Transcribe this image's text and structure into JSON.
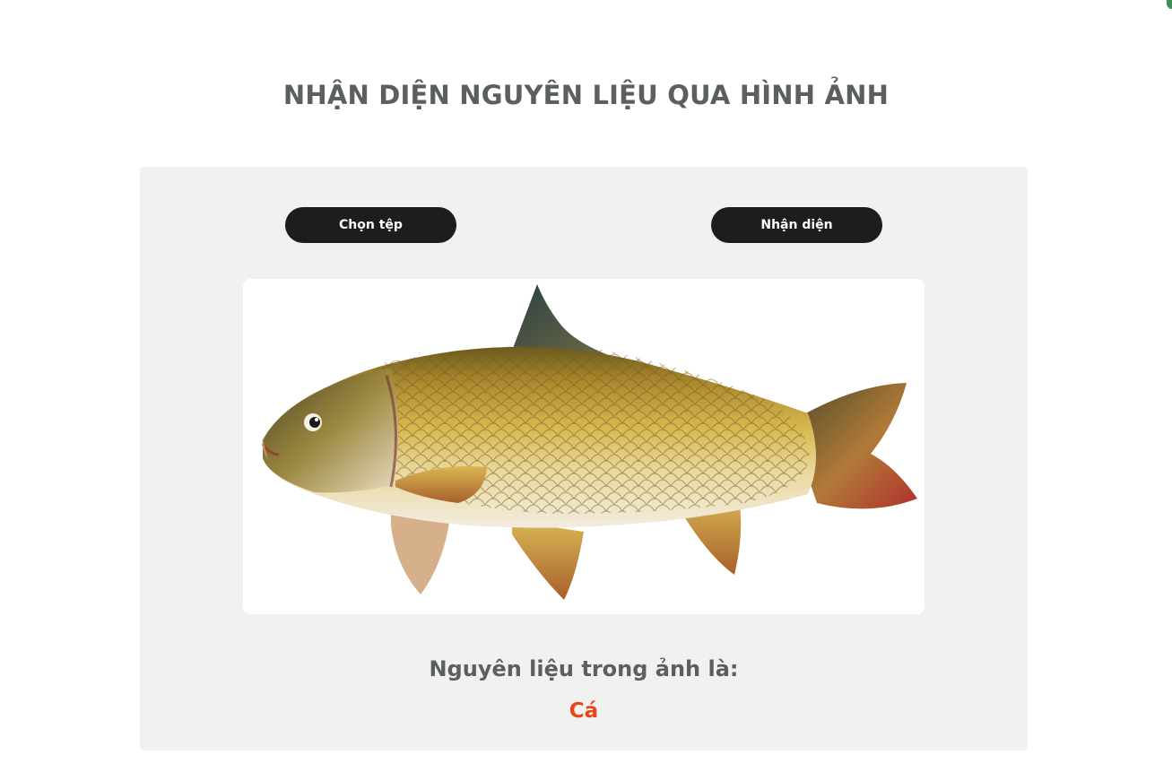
{
  "page": {
    "title": "NHẬN DIỆN NGUYÊN LIỆU QUA HÌNH ẢNH"
  },
  "controls": {
    "choose_file_label": "Chọn tệp",
    "recognize_label": "Nhận diện"
  },
  "preview": {
    "image_subject": "carp-fish-photo"
  },
  "result": {
    "label": "Nguyên liệu trong ảnh là:",
    "value": "Cá"
  },
  "colors": {
    "title": "#5b5f60",
    "panel_background": "#f1f1f1",
    "button_background": "#1f1d1c",
    "button_text": "#ffffff",
    "result_value": "#e8451a"
  }
}
